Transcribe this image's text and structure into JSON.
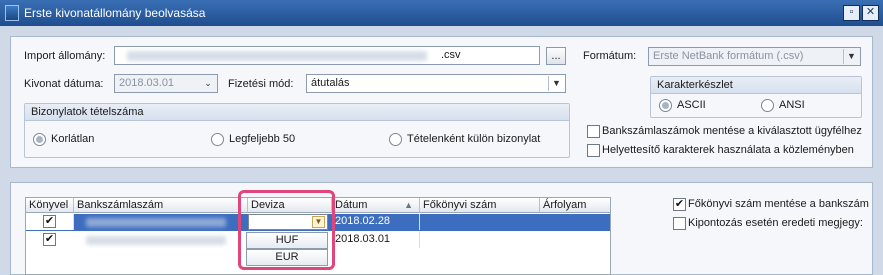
{
  "window": {
    "title": "Erste kivonatállomány beolvasása",
    "minimize_icon": "restore-icon",
    "close_icon": "close-icon"
  },
  "import": {
    "file_label": "Import állomány:",
    "file_suffix": ".csv",
    "browse_label": "...",
    "date_label": "Kivonat dátuma:",
    "date_value": "2018.03.01",
    "payment_label": "Fizetési mód:",
    "payment_value": "átutalás"
  },
  "format": {
    "label": "Formátum:",
    "value": "Erste NetBank formátum (.csv)"
  },
  "charset": {
    "title": "Karakterkészlet",
    "options": [
      "ASCII",
      "ANSI"
    ],
    "selected": "ASCII"
  },
  "items_group": {
    "title": "Bizonylatok tételszáma",
    "options": [
      "Korlátlan",
      "Legfeljebb 50",
      "Tételenként külön bizonylat"
    ],
    "selected": "Korlátlan"
  },
  "options": {
    "save_accounts": "Bankszámlaszámok mentése a kiválasztott ügyfélhez",
    "replace_chars": "Helyettesítő karakterek használata a közleményben",
    "save_ledger": "Főkönyvi szám mentése a bankszám",
    "keep_original": "Kipontozás esetén eredeti megjegy:"
  },
  "grid": {
    "columns": [
      "Könyvel",
      "Bankszámlaszám",
      "Deviza",
      "Dátum",
      "Főkönyvi szám",
      "Árfolyam"
    ],
    "rows": [
      {
        "checked": true,
        "date": "2018.02.28"
      },
      {
        "checked": true,
        "date": "2018.03.01"
      }
    ],
    "currency_options": [
      "HUF",
      "EUR"
    ]
  }
}
